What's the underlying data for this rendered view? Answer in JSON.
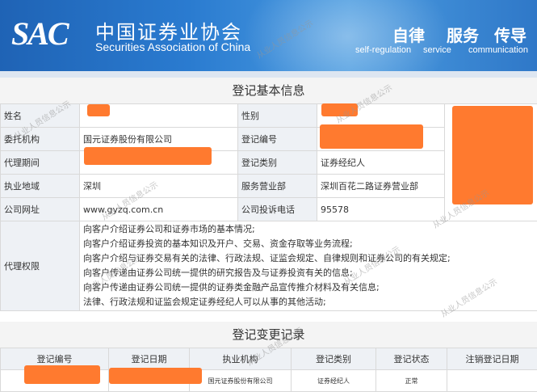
{
  "header": {
    "logo": "SAC",
    "org_cn": "中国证券业协会",
    "org_en": "Securities Association of China",
    "motto": [
      {
        "cn": "自律",
        "en": "self-regulation"
      },
      {
        "cn": "服务",
        "en": "service"
      },
      {
        "cn": "传导",
        "en": "communication"
      }
    ]
  },
  "basic_info": {
    "title": "登记基本信息",
    "labels": {
      "name": "姓名",
      "gender": "性别",
      "agency": "委托机构",
      "reg_no": "登记编号",
      "agent_period": "代理期间",
      "reg_category": "登记类别",
      "location": "执业地域",
      "service_dept": "服务营业部",
      "website": "公司网址",
      "complaint_phone": "公司投诉电话",
      "authority": "代理权限"
    },
    "values": {
      "agency": "国元证券股份有限公司",
      "reg_category": "证券经纪人",
      "location": "深圳",
      "service_dept": "深圳百花二路证券营业部",
      "website": "www.gyzq.com.cn",
      "complaint_phone": "95578"
    },
    "authority_lines": [
      "向客户介绍证券公司和证券市场的基本情况;",
      "向客户介绍证券投资的基本知识及开户、交易、资金存取等业务流程;",
      "向客户介绍与证券交易有关的法律、行政法规、证监会规定、自律规则和证券公司的有关规定;",
      "向客户传递由证券公司统一提供的研究报告及与证券投资有关的信息;",
      "向客户传递由证券公司统一提供的证券类金融产品宣传推介材料及有关信息;",
      "法律、行政法规和证监会规定证券经纪人可以从事的其他活动;"
    ]
  },
  "change_records": {
    "title": "登记变更记录",
    "columns": [
      "登记编号",
      "登记日期",
      "执业机构",
      "登记类别",
      "登记状态",
      "注销登记日期"
    ],
    "rows": [
      {
        "institution": "国元证券股份有限公司",
        "category": "证券经纪人",
        "status": "正常"
      }
    ]
  },
  "watermark": "从业人员信息公示"
}
